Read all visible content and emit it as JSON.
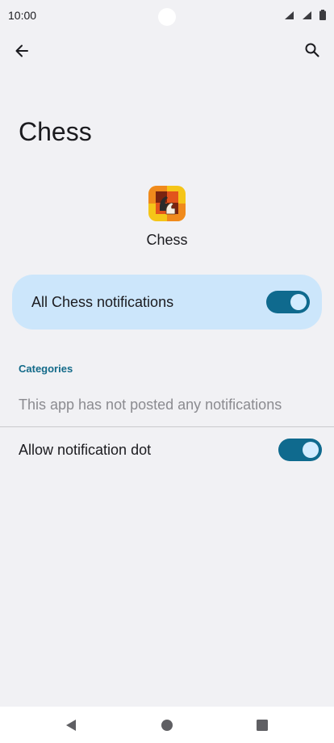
{
  "status_bar": {
    "time": "10:00",
    "icons": [
      "wifi-icon",
      "signal-icon",
      "signal-icon",
      "battery-icon"
    ]
  },
  "app_bar": {
    "back_icon": "arrow-back-icon",
    "search_icon": "search-icon"
  },
  "page": {
    "title": "Chess"
  },
  "app_header": {
    "icon": "chess-app-icon",
    "name": "Chess"
  },
  "main_toggle": {
    "label": "All Chess notifications",
    "checked": true
  },
  "categories": {
    "header": "Categories",
    "empty_message": "This app has not posted any notifications"
  },
  "notification_dot": {
    "label": "Allow notification dot",
    "checked": true
  },
  "nav_bar": {
    "buttons": [
      "back-triangle-icon",
      "home-circle-icon",
      "recents-square-icon"
    ]
  },
  "colors": {
    "background": "#f1f1f4",
    "card": "#cce6fb",
    "accent": "#0f6a8e",
    "switch_thumb": "#d3ecff",
    "section_header": "#136a89"
  }
}
